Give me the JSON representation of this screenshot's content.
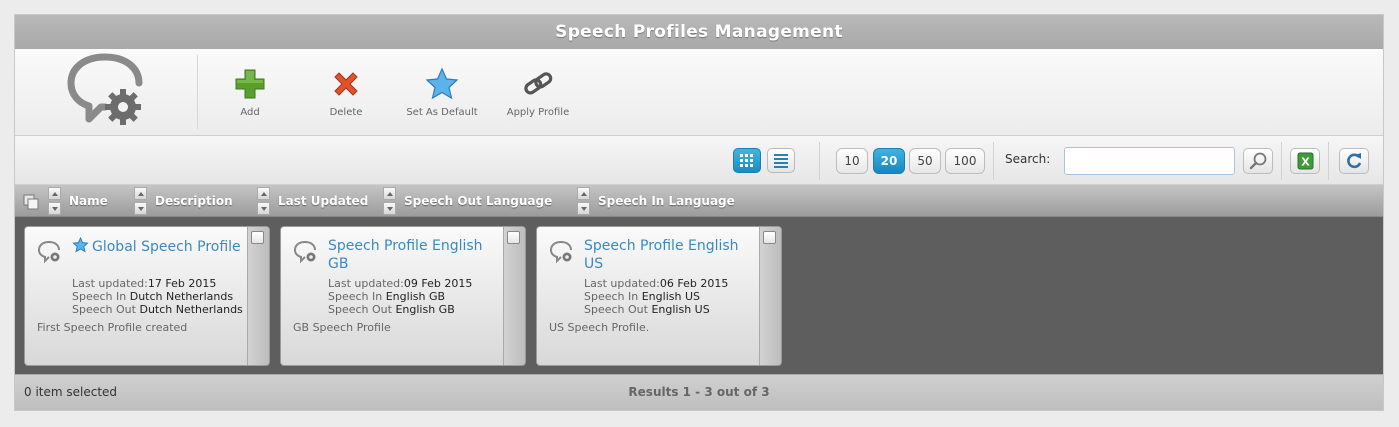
{
  "window": {
    "title": "Speech Profiles Management"
  },
  "toolbar": {
    "logo_icon": "speech-gear-icon",
    "buttons": [
      {
        "label": "Add",
        "icon": "plus-icon",
        "color": "#5a9e2c"
      },
      {
        "label": "Delete",
        "icon": "x-icon",
        "color": "#d9461e"
      },
      {
        "label": "Set As Default",
        "icon": "star-icon",
        "color": "#4aa3e0"
      },
      {
        "label": "Apply Profile",
        "icon": "chain-link-icon",
        "color": "#555555"
      }
    ]
  },
  "controls": {
    "views": [
      {
        "name": "grid",
        "icon": "grid-view-icon",
        "active": true
      },
      {
        "name": "list",
        "icon": "list-view-icon",
        "active": false
      }
    ],
    "page_sizes": [
      "10",
      "20",
      "50",
      "100"
    ],
    "active_page_size": "20",
    "search": {
      "label": "Search:",
      "value": "",
      "placeholder": ""
    },
    "search_button_icon": "magnifier-icon",
    "export_icon": "excel-icon",
    "refresh_icon": "refresh-icon"
  },
  "columns": [
    "Name",
    "Description",
    "Last Updated",
    "Speech Out Language",
    "Speech In Language"
  ],
  "labels": {
    "last_updated": "Last updated:",
    "speech_in": "Speech In",
    "speech_out": "Speech Out"
  },
  "profiles": [
    {
      "name": "Global Speech Profile",
      "is_default": true,
      "last_updated": "17 Feb 2015",
      "speech_in": "Dutch Netherlands",
      "speech_out": "Dutch Netherlands",
      "description": "First Speech Profile created"
    },
    {
      "name": "Speech Profile English GB",
      "is_default": false,
      "last_updated": "09 Feb 2015",
      "speech_in": "English GB",
      "speech_out": "English GB",
      "description": "GB Speech Profile"
    },
    {
      "name": "Speech Profile English US",
      "is_default": false,
      "last_updated": "06 Feb 2015",
      "speech_in": "English US",
      "speech_out": "English US",
      "description": "US Speech Profile."
    }
  ],
  "footer": {
    "selection": "0 item selected",
    "results": "Results 1 - 3 out of 3"
  },
  "colors": {
    "accent": "#1f93c9",
    "link": "#3a8ac2",
    "content_bg": "#5e5e5e"
  }
}
